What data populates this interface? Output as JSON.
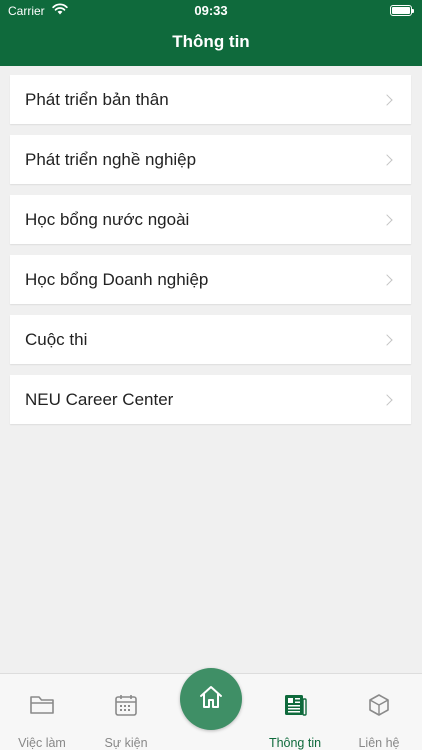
{
  "status_bar": {
    "carrier": "Carrier",
    "time": "09:33"
  },
  "header": {
    "title": "Thông tin"
  },
  "menu": [
    {
      "label": "Phát triển bản thân"
    },
    {
      "label": "Phát triển nghề nghiệp"
    },
    {
      "label": "Học bổng nước ngoài"
    },
    {
      "label": "Học bổng Doanh nghiệp"
    },
    {
      "label": "Cuộc thi"
    },
    {
      "label": "NEU Career Center"
    }
  ],
  "tabs": [
    {
      "label": "Việc làm",
      "icon": "folder-icon"
    },
    {
      "label": "Sự kiện",
      "icon": "calendar-icon"
    },
    {
      "label": "Thông tin",
      "icon": "newspaper-icon",
      "active": true
    },
    {
      "label": "Liên hệ",
      "icon": "cube-icon"
    }
  ],
  "home": {
    "icon": "home-icon"
  },
  "colors": {
    "brand": "#0f6a3c",
    "home_button": "#3f8f66",
    "background": "#f0f0f0"
  }
}
